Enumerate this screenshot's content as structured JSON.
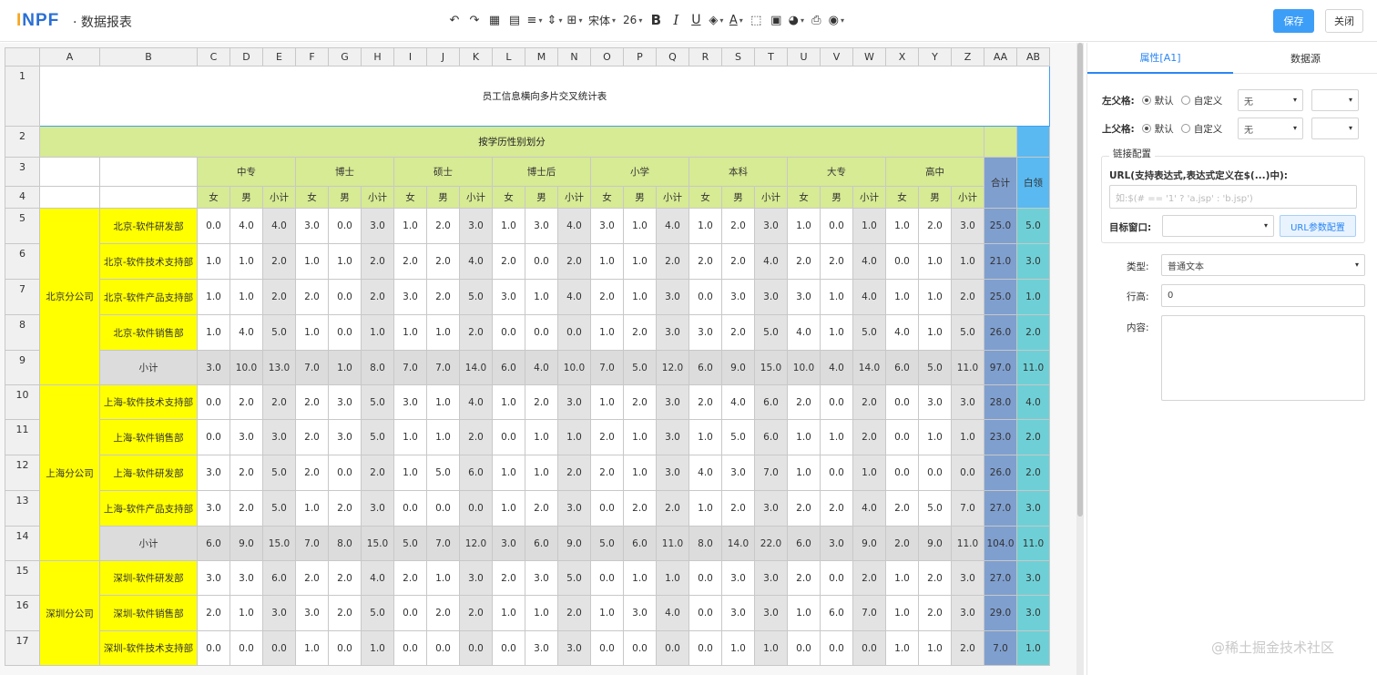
{
  "app": {
    "logo_prefix": "I",
    "logo_rest": "NPF",
    "separator": "·",
    "title": "数据报表"
  },
  "toolbar": {
    "font_name": "宋体",
    "font_size": "26",
    "bold": "B",
    "italic": "I",
    "underline": "U",
    "font_color": "A",
    "save_label": "保存",
    "close_label": "关闭",
    "icons": [
      "undo-icon",
      "redo-icon",
      "excel-icon",
      "table-icon",
      "align-icon",
      "valign-icon",
      "border-icon",
      "font-select",
      "font-size-select",
      "bold-icon",
      "italic-icon",
      "underline-icon",
      "fill-color-icon",
      "font-color-icon",
      "clear-icon",
      "image-icon",
      "chart-icon",
      "print-icon",
      "preview-icon"
    ]
  },
  "sheet": {
    "columns": [
      "A",
      "B",
      "C",
      "D",
      "E",
      "F",
      "G",
      "H",
      "I",
      "J",
      "K",
      "L",
      "M",
      "N",
      "O",
      "P",
      "Q",
      "R",
      "S",
      "T",
      "U",
      "V",
      "W",
      "X",
      "Y",
      "Z",
      "AA",
      "AB"
    ],
    "rows": [
      "1",
      "2",
      "3",
      "4",
      "5",
      "6",
      "7",
      "8",
      "9",
      "10",
      "11",
      "12",
      "13",
      "14",
      "15",
      "16",
      "17"
    ],
    "title": "员工信息横向多片交叉统计表",
    "banner": "按学历性别划分",
    "education": [
      "中专",
      "博士",
      "硕士",
      "博士后",
      "小学",
      "本科",
      "大专",
      "高中"
    ],
    "gender_sub": [
      "女",
      "男",
      "小计"
    ],
    "total_label": "合计",
    "extra_label": "白领",
    "subtotal_label": "小计",
    "branches": [
      {
        "name": "北京分公司",
        "depts": [
          {
            "name": "北京-软件研发部",
            "values": [
              "0.0",
              "4.0",
              "4.0",
              "3.0",
              "0.0",
              "3.0",
              "1.0",
              "2.0",
              "3.0",
              "1.0",
              "3.0",
              "4.0",
              "3.0",
              "1.0",
              "4.0",
              "1.0",
              "2.0",
              "3.0",
              "1.0",
              "0.0",
              "1.0",
              "1.0",
              "2.0",
              "3.0",
              "25.0",
              "5.0"
            ]
          },
          {
            "name": "北京-软件技术支持部",
            "values": [
              "1.0",
              "1.0",
              "2.0",
              "1.0",
              "1.0",
              "2.0",
              "2.0",
              "2.0",
              "4.0",
              "2.0",
              "0.0",
              "2.0",
              "1.0",
              "1.0",
              "2.0",
              "2.0",
              "2.0",
              "4.0",
              "2.0",
              "2.0",
              "4.0",
              "0.0",
              "1.0",
              "1.0",
              "21.0",
              "3.0"
            ]
          },
          {
            "name": "北京-软件产品支持部",
            "values": [
              "1.0",
              "1.0",
              "2.0",
              "2.0",
              "0.0",
              "2.0",
              "3.0",
              "2.0",
              "5.0",
              "3.0",
              "1.0",
              "4.0",
              "2.0",
              "1.0",
              "3.0",
              "0.0",
              "3.0",
              "3.0",
              "3.0",
              "1.0",
              "4.0",
              "1.0",
              "1.0",
              "2.0",
              "25.0",
              "1.0"
            ]
          },
          {
            "name": "北京-软件销售部",
            "values": [
              "1.0",
              "4.0",
              "5.0",
              "1.0",
              "0.0",
              "1.0",
              "1.0",
              "1.0",
              "2.0",
              "0.0",
              "0.0",
              "0.0",
              "1.0",
              "2.0",
              "3.0",
              "3.0",
              "2.0",
              "5.0",
              "4.0",
              "1.0",
              "5.0",
              "4.0",
              "1.0",
              "5.0",
              "26.0",
              "2.0"
            ]
          }
        ],
        "subtotal": [
          "3.0",
          "10.0",
          "13.0",
          "7.0",
          "1.0",
          "8.0",
          "7.0",
          "7.0",
          "14.0",
          "6.0",
          "4.0",
          "10.0",
          "7.0",
          "5.0",
          "12.0",
          "6.0",
          "9.0",
          "15.0",
          "10.0",
          "4.0",
          "14.0",
          "6.0",
          "5.0",
          "11.0",
          "97.0",
          "11.0"
        ]
      },
      {
        "name": "上海分公司",
        "depts": [
          {
            "name": "上海-软件技术支持部",
            "values": [
              "0.0",
              "2.0",
              "2.0",
              "2.0",
              "3.0",
              "5.0",
              "3.0",
              "1.0",
              "4.0",
              "1.0",
              "2.0",
              "3.0",
              "1.0",
              "2.0",
              "3.0",
              "2.0",
              "4.0",
              "6.0",
              "2.0",
              "0.0",
              "2.0",
              "0.0",
              "3.0",
              "3.0",
              "28.0",
              "4.0"
            ]
          },
          {
            "name": "上海-软件销售部",
            "values": [
              "0.0",
              "3.0",
              "3.0",
              "2.0",
              "3.0",
              "5.0",
              "1.0",
              "1.0",
              "2.0",
              "0.0",
              "1.0",
              "1.0",
              "2.0",
              "1.0",
              "3.0",
              "1.0",
              "5.0",
              "6.0",
              "1.0",
              "1.0",
              "2.0",
              "0.0",
              "1.0",
              "1.0",
              "23.0",
              "2.0"
            ]
          },
          {
            "name": "上海-软件研发部",
            "values": [
              "3.0",
              "2.0",
              "5.0",
              "2.0",
              "0.0",
              "2.0",
              "1.0",
              "5.0",
              "6.0",
              "1.0",
              "1.0",
              "2.0",
              "2.0",
              "1.0",
              "3.0",
              "4.0",
              "3.0",
              "7.0",
              "1.0",
              "0.0",
              "1.0",
              "0.0",
              "0.0",
              "0.0",
              "26.0",
              "2.0"
            ]
          },
          {
            "name": "上海-软件产品支持部",
            "values": [
              "3.0",
              "2.0",
              "5.0",
              "1.0",
              "2.0",
              "3.0",
              "0.0",
              "0.0",
              "0.0",
              "1.0",
              "2.0",
              "3.0",
              "0.0",
              "2.0",
              "2.0",
              "1.0",
              "2.0",
              "3.0",
              "2.0",
              "2.0",
              "4.0",
              "2.0",
              "5.0",
              "7.0",
              "27.0",
              "3.0"
            ]
          }
        ],
        "subtotal": [
          "6.0",
          "9.0",
          "15.0",
          "7.0",
          "8.0",
          "15.0",
          "5.0",
          "7.0",
          "12.0",
          "3.0",
          "6.0",
          "9.0",
          "5.0",
          "6.0",
          "11.0",
          "8.0",
          "14.0",
          "22.0",
          "6.0",
          "3.0",
          "9.0",
          "2.0",
          "9.0",
          "11.0",
          "104.0",
          "11.0"
        ]
      },
      {
        "name": "深圳分公司",
        "depts": [
          {
            "name": "深圳-软件研发部",
            "values": [
              "3.0",
              "3.0",
              "6.0",
              "2.0",
              "2.0",
              "4.0",
              "2.0",
              "1.0",
              "3.0",
              "2.0",
              "3.0",
              "5.0",
              "0.0",
              "1.0",
              "1.0",
              "0.0",
              "3.0",
              "3.0",
              "2.0",
              "0.0",
              "2.0",
              "1.0",
              "2.0",
              "3.0",
              "27.0",
              "3.0"
            ]
          },
          {
            "name": "深圳-软件销售部",
            "values": [
              "2.0",
              "1.0",
              "3.0",
              "3.0",
              "2.0",
              "5.0",
              "0.0",
              "2.0",
              "2.0",
              "1.0",
              "1.0",
              "2.0",
              "1.0",
              "3.0",
              "4.0",
              "0.0",
              "3.0",
              "3.0",
              "1.0",
              "6.0",
              "7.0",
              "1.0",
              "2.0",
              "3.0",
              "29.0",
              "3.0"
            ]
          },
          {
            "name": "深圳-软件技术支持部",
            "values": [
              "0.0",
              "0.0",
              "0.0",
              "1.0",
              "0.0",
              "1.0",
              "0.0",
              "0.0",
              "0.0",
              "0.0",
              "3.0",
              "3.0",
              "0.0",
              "0.0",
              "0.0",
              "0.0",
              "1.0",
              "1.0",
              "0.0",
              "0.0",
              "0.0",
              "1.0",
              "1.0",
              "2.0",
              "7.0",
              "1.0"
            ]
          }
        ]
      }
    ]
  },
  "panel": {
    "tabs": [
      "属性[A1]",
      "数据源"
    ],
    "left_parent_label": "左父格:",
    "top_parent_label": "上父格:",
    "opt_default": "默认",
    "opt_custom": "自定义",
    "none_option": "无",
    "link_legend": "链接配置",
    "url_label": "URL(支持表达式,表达式定义在$(...)中):",
    "url_placeholder": "如:$(# == '1' ? 'a.jsp' : 'b.jsp')",
    "target_label": "目标窗口:",
    "url_param_button": "URL参数配置",
    "type_label": "类型:",
    "type_value": "普通文本",
    "row_height_label": "行高:",
    "row_height_value": "0",
    "content_label": "内容:"
  },
  "watermark": "@稀土掘金技术社区",
  "colors": {
    "accent": "#3d9ef8",
    "header_green": "#d7ea94",
    "branch_yellow": "#ffff00",
    "total_blue": "#7f9fcf",
    "extra_cyan": "#6ed0d6"
  }
}
